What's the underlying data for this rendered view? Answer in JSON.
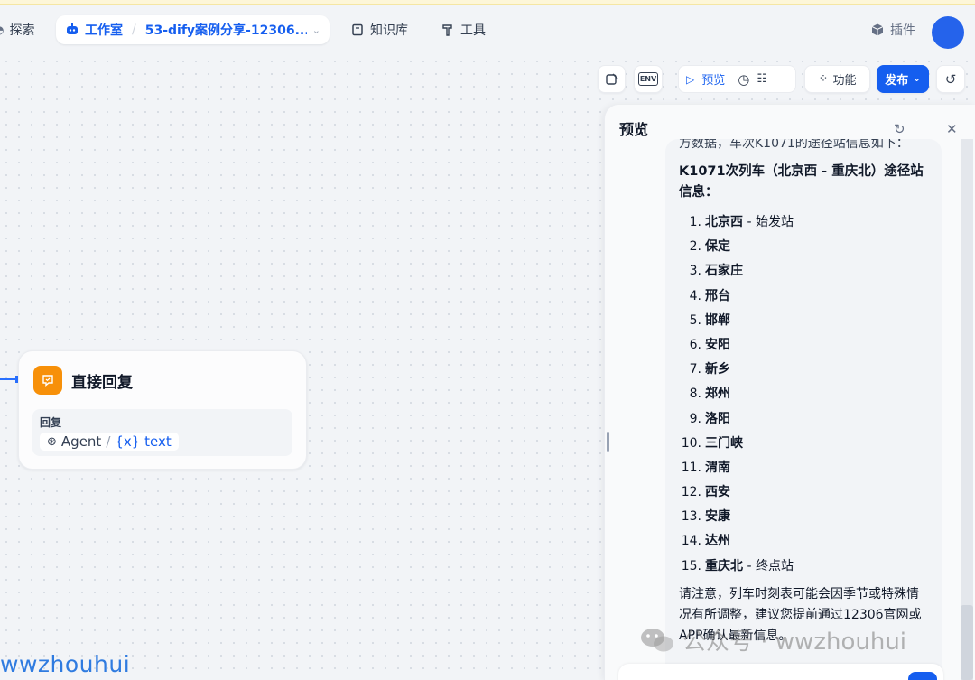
{
  "topbar": {
    "explore_label": "探索",
    "studio_label": "工作室",
    "app_name": "53-dify案例分享-12306...",
    "knowledge_label": "知识库",
    "tools_label": "工具",
    "plugins_label": "插件"
  },
  "toolbar": {
    "env_label": "ENV",
    "preview_label": "预览",
    "features_label": "功能",
    "publish_label": "发布"
  },
  "node": {
    "title": "直接回复",
    "field_label": "回复",
    "var_source": "Agent",
    "var_sep": "/",
    "var_name": "{x} text"
  },
  "preview_panel": {
    "title": "预览",
    "cut_line": "方数据，车次K1071的途径站信息如下：",
    "heading": "K1071次列车（北京西 - 重庆北）途径站信息：",
    "stations": [
      {
        "num": "1.",
        "name": "北京西",
        "note": " - 始发站"
      },
      {
        "num": "2.",
        "name": "保定",
        "note": ""
      },
      {
        "num": "3.",
        "name": "石家庄",
        "note": ""
      },
      {
        "num": "4.",
        "name": "邢台",
        "note": ""
      },
      {
        "num": "5.",
        "name": "邯郸",
        "note": ""
      },
      {
        "num": "6.",
        "name": "安阳",
        "note": ""
      },
      {
        "num": "7.",
        "name": "新乡",
        "note": ""
      },
      {
        "num": "8.",
        "name": "郑州",
        "note": ""
      },
      {
        "num": "9.",
        "name": "洛阳",
        "note": ""
      },
      {
        "num": "10.",
        "name": "三门峡",
        "note": ""
      },
      {
        "num": "11.",
        "name": "渭南",
        "note": ""
      },
      {
        "num": "12.",
        "name": "西安",
        "note": ""
      },
      {
        "num": "13.",
        "name": "安康",
        "note": ""
      },
      {
        "num": "14.",
        "name": "达州",
        "note": ""
      },
      {
        "num": "15.",
        "name": "重庆北",
        "note": " - 终点站"
      }
    ],
    "note": "请注意，列车时刻表可能会因季节或特殊情况有所调整，建议您提前通过12306官网或APP确认最新信息。"
  },
  "watermarks": {
    "wechat": "公众号 · wwzhouhui",
    "corner": "wwzhouhui"
  },
  "colors": {
    "accent": "#155eef",
    "node_icon": "#f79009",
    "avatar": "#2563eb"
  }
}
